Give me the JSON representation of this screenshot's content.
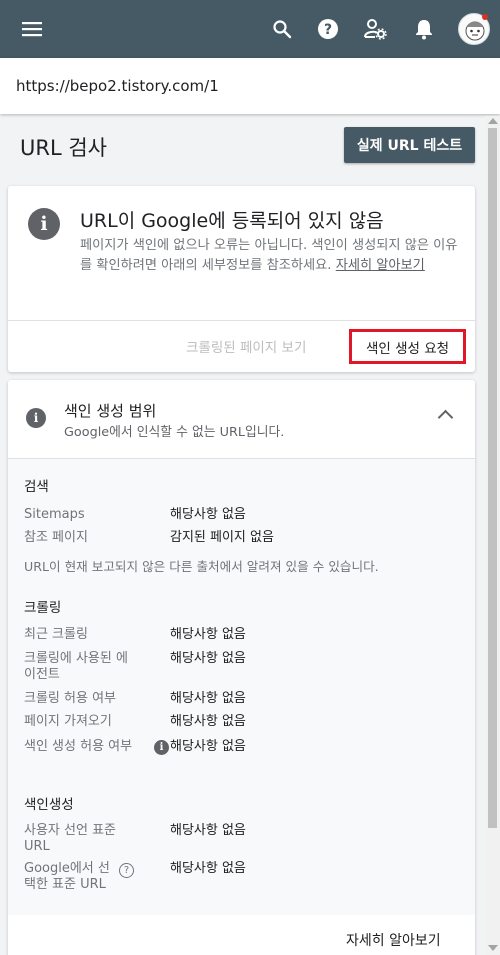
{
  "appbar": {
    "icons": [
      "menu-icon",
      "search-icon",
      "help-icon",
      "admin-settings-icon",
      "notifications-icon"
    ],
    "color": "#455a64"
  },
  "url_bar": {
    "value": "https://bepo2.tistory.com/1"
  },
  "header": {
    "title": "URL 검사",
    "live_test_label": "실제 URL 테스트"
  },
  "status_card": {
    "title": "URL이 Google에 등록되어 있지 않음",
    "description": "페이지가 색인에 없으나 오류는 아닙니다. 색인이 생성되지 않은 이유를 확인하려면 아래의 세부정보를 참조하세요.",
    "learn_more": "자세히 알아보기",
    "crawled_page_label": "크롤링된 페이지 보기",
    "request_index_label": "색인 생성 요청",
    "highlight_color": "#e0162b"
  },
  "coverage": {
    "title": "색인 생성 범위",
    "subtitle": "Google에서 인식할 수 없는 URL입니다.",
    "search": {
      "title": "검색",
      "rows": [
        {
          "label": "Sitemaps",
          "value": "해당사항 없음"
        },
        {
          "label": "참조 페이지",
          "value": "감지된 페이지 없음"
        }
      ],
      "note": "URL이 현재 보고되지 않은 다른 출처에서 알려져 있을 수 있습니다."
    },
    "crawl": {
      "title": "크롤링",
      "rows": [
        {
          "label": "최근 크롤링",
          "value": "해당사항 없음"
        },
        {
          "label": "크롤링에 사용된 에이전트",
          "value": "해당사항 없음"
        },
        {
          "label": "크롤링 허용 여부",
          "value": "해당사항 없음"
        },
        {
          "label": "페이지 가져오기",
          "value": "해당사항 없음"
        },
        {
          "label": "색인 생성 허용 여부",
          "value": "해당사항 없음"
        }
      ]
    },
    "indexing": {
      "title": "색인생성",
      "rows": [
        {
          "label": "사용자 선언 표준 URL",
          "value": "해당사항 없음"
        },
        {
          "label": "Google에서 선택한 표준 URL",
          "value": "해당사항 없음"
        }
      ]
    },
    "learn_more": "자세히 알아보기"
  }
}
